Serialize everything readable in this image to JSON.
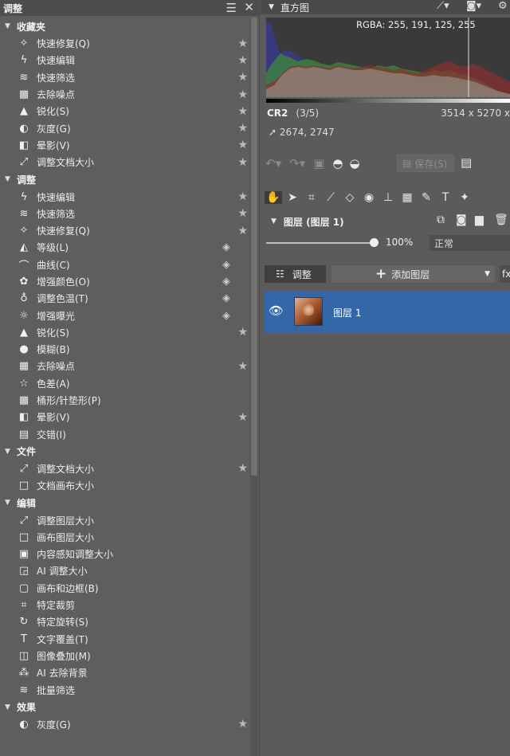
{
  "left_panel": {
    "title": "调整",
    "menu_icon": "hamburger-icon",
    "close_icon": "close-icon",
    "sections": [
      {
        "title": "收藏夹",
        "items": [
          {
            "label": "快速修复(Q)",
            "icon": "magic-wand-icon",
            "star": true
          },
          {
            "label": "快速编辑",
            "icon": "lightning-icon",
            "star": true
          },
          {
            "label": "快速筛选",
            "icon": "filter-stack-icon",
            "star": true
          },
          {
            "label": "去除噪点",
            "icon": "noise-icon",
            "star": true
          },
          {
            "label": "锐化(S)",
            "icon": "triangle-icon",
            "star": true
          },
          {
            "label": "灰度(G)",
            "icon": "grayscale-icon",
            "star": true
          },
          {
            "label": "晕影(V)",
            "icon": "vignette-icon",
            "star": true
          },
          {
            "label": "调整文档大小",
            "icon": "resize-arrows-icon",
            "star": true
          }
        ]
      },
      {
        "title": "调整",
        "items": [
          {
            "label": "快速编辑",
            "icon": "lightning-icon",
            "star": true
          },
          {
            "label": "快速筛选",
            "icon": "filter-stack-icon",
            "star": true
          },
          {
            "label": "快速修复(Q)",
            "icon": "magic-wand-icon",
            "star": true
          },
          {
            "label": "等级(L)",
            "icon": "levels-icon",
            "layers": true
          },
          {
            "label": "曲线(C)",
            "icon": "curves-icon",
            "layers": true
          },
          {
            "label": "增强颜色(O)",
            "icon": "palette-icon",
            "layers": true
          },
          {
            "label": "调整色温(T)",
            "icon": "bulb-icon",
            "layers": true
          },
          {
            "label": "增强曝光",
            "icon": "sun-icon",
            "layers": true
          },
          {
            "label": "锐化(S)",
            "icon": "triangle-icon",
            "star": true
          },
          {
            "label": "模糊(B)",
            "icon": "drop-icon"
          },
          {
            "label": "去除噪点",
            "icon": "noise-icon",
            "star": true
          },
          {
            "label": "色差(A)",
            "icon": "star-outline-icon"
          },
          {
            "label": "桶形/针垫形(P)",
            "icon": "grid-icon"
          },
          {
            "label": "晕影(V)",
            "icon": "vignette-icon",
            "star": true
          },
          {
            "label": "交错(I)",
            "icon": "interlace-icon"
          }
        ]
      },
      {
        "title": "文件",
        "items": [
          {
            "label": "调整文档大小",
            "icon": "resize-arrows-icon",
            "star": true
          },
          {
            "label": "文档画布大小",
            "icon": "canvas-icon"
          }
        ]
      },
      {
        "title": "编辑",
        "items": [
          {
            "label": "调整图层大小",
            "icon": "resize-arrows-icon"
          },
          {
            "label": "画布图层大小",
            "icon": "canvas-icon"
          },
          {
            "label": "内容感知调整大小",
            "icon": "content-aware-icon"
          },
          {
            "label": "AI 调整大小",
            "icon": "ai-resize-icon"
          },
          {
            "label": "画布和边框(B)",
            "icon": "frame-icon"
          },
          {
            "label": "特定裁剪",
            "icon": "crop-icon"
          },
          {
            "label": "特定旋转(S)",
            "icon": "rotate-icon"
          },
          {
            "label": "文字覆盖(T)",
            "icon": "text-icon"
          },
          {
            "label": "图像叠加(M)",
            "icon": "image-overlay-icon"
          },
          {
            "label": "AI 去除背景",
            "icon": "ai-remove-bg-icon"
          },
          {
            "label": "批量筛选",
            "icon": "filter-stack-icon"
          }
        ]
      },
      {
        "title": "效果",
        "items": [
          {
            "label": "灰度(G)",
            "icon": "grayscale-icon",
            "star": true
          }
        ]
      }
    ]
  },
  "histogram": {
    "title": "直方图",
    "rgba": "RGBA: 255, 191, 125, 255"
  },
  "image_info": {
    "format": "CR2",
    "count": "(3/5)",
    "dimensions": "3514 x 5270 x",
    "cursor": "2674, 2747"
  },
  "toolbar": {
    "save_label": "保存(S)"
  },
  "layers": {
    "title": "图层 (图层 1)",
    "opacity": "100%",
    "opacity_fraction": 1.0,
    "blend_mode": "正常",
    "adjust_label": "调整",
    "add_layer_label": "添加图层",
    "fx_label": "fx",
    "items": [
      {
        "name": "图层 1",
        "visible": true,
        "selected": true
      }
    ]
  },
  "colors": {
    "selected_layer": "#3467a8",
    "panel_bg": "#5e5e5e"
  }
}
